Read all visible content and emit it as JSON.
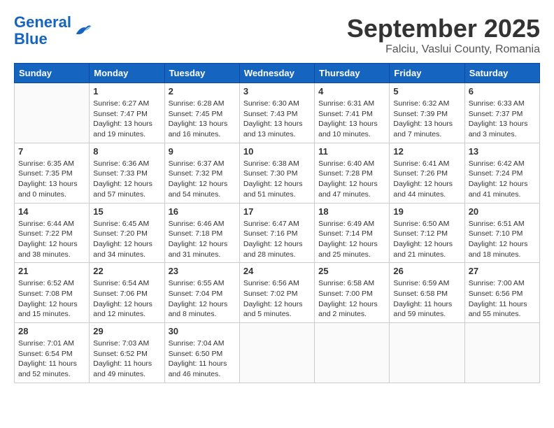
{
  "header": {
    "logo_line1": "General",
    "logo_line2": "Blue",
    "month_title": "September 2025",
    "location": "Falciu, Vaslui County, Romania"
  },
  "weekdays": [
    "Sunday",
    "Monday",
    "Tuesday",
    "Wednesday",
    "Thursday",
    "Friday",
    "Saturday"
  ],
  "weeks": [
    [
      {
        "day": "",
        "info": ""
      },
      {
        "day": "1",
        "info": "Sunrise: 6:27 AM\nSunset: 7:47 PM\nDaylight: 13 hours\nand 19 minutes."
      },
      {
        "day": "2",
        "info": "Sunrise: 6:28 AM\nSunset: 7:45 PM\nDaylight: 13 hours\nand 16 minutes."
      },
      {
        "day": "3",
        "info": "Sunrise: 6:30 AM\nSunset: 7:43 PM\nDaylight: 13 hours\nand 13 minutes."
      },
      {
        "day": "4",
        "info": "Sunrise: 6:31 AM\nSunset: 7:41 PM\nDaylight: 13 hours\nand 10 minutes."
      },
      {
        "day": "5",
        "info": "Sunrise: 6:32 AM\nSunset: 7:39 PM\nDaylight: 13 hours\nand 7 minutes."
      },
      {
        "day": "6",
        "info": "Sunrise: 6:33 AM\nSunset: 7:37 PM\nDaylight: 13 hours\nand 3 minutes."
      }
    ],
    [
      {
        "day": "7",
        "info": "Sunrise: 6:35 AM\nSunset: 7:35 PM\nDaylight: 13 hours\nand 0 minutes."
      },
      {
        "day": "8",
        "info": "Sunrise: 6:36 AM\nSunset: 7:33 PM\nDaylight: 12 hours\nand 57 minutes."
      },
      {
        "day": "9",
        "info": "Sunrise: 6:37 AM\nSunset: 7:32 PM\nDaylight: 12 hours\nand 54 minutes."
      },
      {
        "day": "10",
        "info": "Sunrise: 6:38 AM\nSunset: 7:30 PM\nDaylight: 12 hours\nand 51 minutes."
      },
      {
        "day": "11",
        "info": "Sunrise: 6:40 AM\nSunset: 7:28 PM\nDaylight: 12 hours\nand 47 minutes."
      },
      {
        "day": "12",
        "info": "Sunrise: 6:41 AM\nSunset: 7:26 PM\nDaylight: 12 hours\nand 44 minutes."
      },
      {
        "day": "13",
        "info": "Sunrise: 6:42 AM\nSunset: 7:24 PM\nDaylight: 12 hours\nand 41 minutes."
      }
    ],
    [
      {
        "day": "14",
        "info": "Sunrise: 6:44 AM\nSunset: 7:22 PM\nDaylight: 12 hours\nand 38 minutes."
      },
      {
        "day": "15",
        "info": "Sunrise: 6:45 AM\nSunset: 7:20 PM\nDaylight: 12 hours\nand 34 minutes."
      },
      {
        "day": "16",
        "info": "Sunrise: 6:46 AM\nSunset: 7:18 PM\nDaylight: 12 hours\nand 31 minutes."
      },
      {
        "day": "17",
        "info": "Sunrise: 6:47 AM\nSunset: 7:16 PM\nDaylight: 12 hours\nand 28 minutes."
      },
      {
        "day": "18",
        "info": "Sunrise: 6:49 AM\nSunset: 7:14 PM\nDaylight: 12 hours\nand 25 minutes."
      },
      {
        "day": "19",
        "info": "Sunrise: 6:50 AM\nSunset: 7:12 PM\nDaylight: 12 hours\nand 21 minutes."
      },
      {
        "day": "20",
        "info": "Sunrise: 6:51 AM\nSunset: 7:10 PM\nDaylight: 12 hours\nand 18 minutes."
      }
    ],
    [
      {
        "day": "21",
        "info": "Sunrise: 6:52 AM\nSunset: 7:08 PM\nDaylight: 12 hours\nand 15 minutes."
      },
      {
        "day": "22",
        "info": "Sunrise: 6:54 AM\nSunset: 7:06 PM\nDaylight: 12 hours\nand 12 minutes."
      },
      {
        "day": "23",
        "info": "Sunrise: 6:55 AM\nSunset: 7:04 PM\nDaylight: 12 hours\nand 8 minutes."
      },
      {
        "day": "24",
        "info": "Sunrise: 6:56 AM\nSunset: 7:02 PM\nDaylight: 12 hours\nand 5 minutes."
      },
      {
        "day": "25",
        "info": "Sunrise: 6:58 AM\nSunset: 7:00 PM\nDaylight: 12 hours\nand 2 minutes."
      },
      {
        "day": "26",
        "info": "Sunrise: 6:59 AM\nSunset: 6:58 PM\nDaylight: 11 hours\nand 59 minutes."
      },
      {
        "day": "27",
        "info": "Sunrise: 7:00 AM\nSunset: 6:56 PM\nDaylight: 11 hours\nand 55 minutes."
      }
    ],
    [
      {
        "day": "28",
        "info": "Sunrise: 7:01 AM\nSunset: 6:54 PM\nDaylight: 11 hours\nand 52 minutes."
      },
      {
        "day": "29",
        "info": "Sunrise: 7:03 AM\nSunset: 6:52 PM\nDaylight: 11 hours\nand 49 minutes."
      },
      {
        "day": "30",
        "info": "Sunrise: 7:04 AM\nSunset: 6:50 PM\nDaylight: 11 hours\nand 46 minutes."
      },
      {
        "day": "",
        "info": ""
      },
      {
        "day": "",
        "info": ""
      },
      {
        "day": "",
        "info": ""
      },
      {
        "day": "",
        "info": ""
      }
    ]
  ]
}
